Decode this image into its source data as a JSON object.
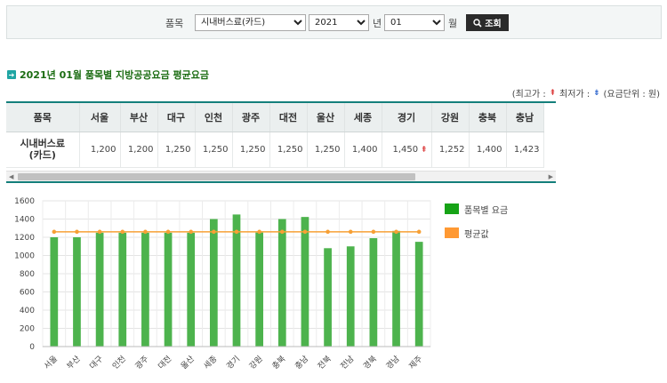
{
  "search": {
    "item_label": "품목",
    "item_value": "시내버스료(카드)",
    "year_value": "2021",
    "year_unit": "년",
    "month_value": "01",
    "month_unit": "월",
    "button_label": "조회"
  },
  "section_title": "2021년 01월 품목별 지방공공요금 평균요금",
  "legend_note": {
    "max_prefix": "(최고가 :",
    "min_prefix": "최저가 :",
    "unit": "(요금단위 : 원)"
  },
  "table": {
    "item_header": "품목",
    "regions": [
      "서울",
      "부산",
      "대구",
      "인천",
      "광주",
      "대전",
      "울산",
      "세종",
      "경기",
      "강원",
      "충북",
      "충남"
    ],
    "row_label_line1": "시내버스료",
    "row_label_line2": "(카드)",
    "values": [
      "1,200",
      "1,200",
      "1,250",
      "1,250",
      "1,250",
      "1,250",
      "1,250",
      "1,400",
      "1,450",
      "1,252",
      "1,400",
      "1,423"
    ],
    "max_marker_region": "경기"
  },
  "chart_data": {
    "type": "bar",
    "categories": [
      "서울",
      "부산",
      "대구",
      "인천",
      "광주",
      "대전",
      "울산",
      "세종",
      "경기",
      "강원",
      "충북",
      "충남",
      "전북",
      "전남",
      "경북",
      "경남",
      "제주"
    ],
    "series": [
      {
        "name": "품목별 요금",
        "type": "bar",
        "color": "#4db34d",
        "values": [
          1200,
          1200,
          1250,
          1250,
          1250,
          1250,
          1250,
          1400,
          1450,
          1252,
          1400,
          1423,
          1080,
          1100,
          1190,
          1270,
          1150
        ]
      },
      {
        "name": "평균값",
        "type": "line",
        "color": "#f7a035",
        "values": [
          1260,
          1260,
          1260,
          1260,
          1260,
          1260,
          1260,
          1260,
          1260,
          1260,
          1260,
          1260,
          1260,
          1260,
          1260,
          1260,
          1260
        ]
      }
    ],
    "y_ticks": [
      "0",
      "200",
      "400",
      "600",
      "800",
      "1000",
      "1200",
      "1400",
      "1600"
    ],
    "ylim": [
      0,
      1600
    ],
    "grid": true,
    "legend_position": "right"
  },
  "colors": {
    "accent_green": "#1b6c12",
    "teal_border": "#147f7b",
    "bar_green": "#4db34d",
    "avg_orange": "#f7a035",
    "legend_green": "#16a316",
    "legend_orange": "#ff9933"
  }
}
